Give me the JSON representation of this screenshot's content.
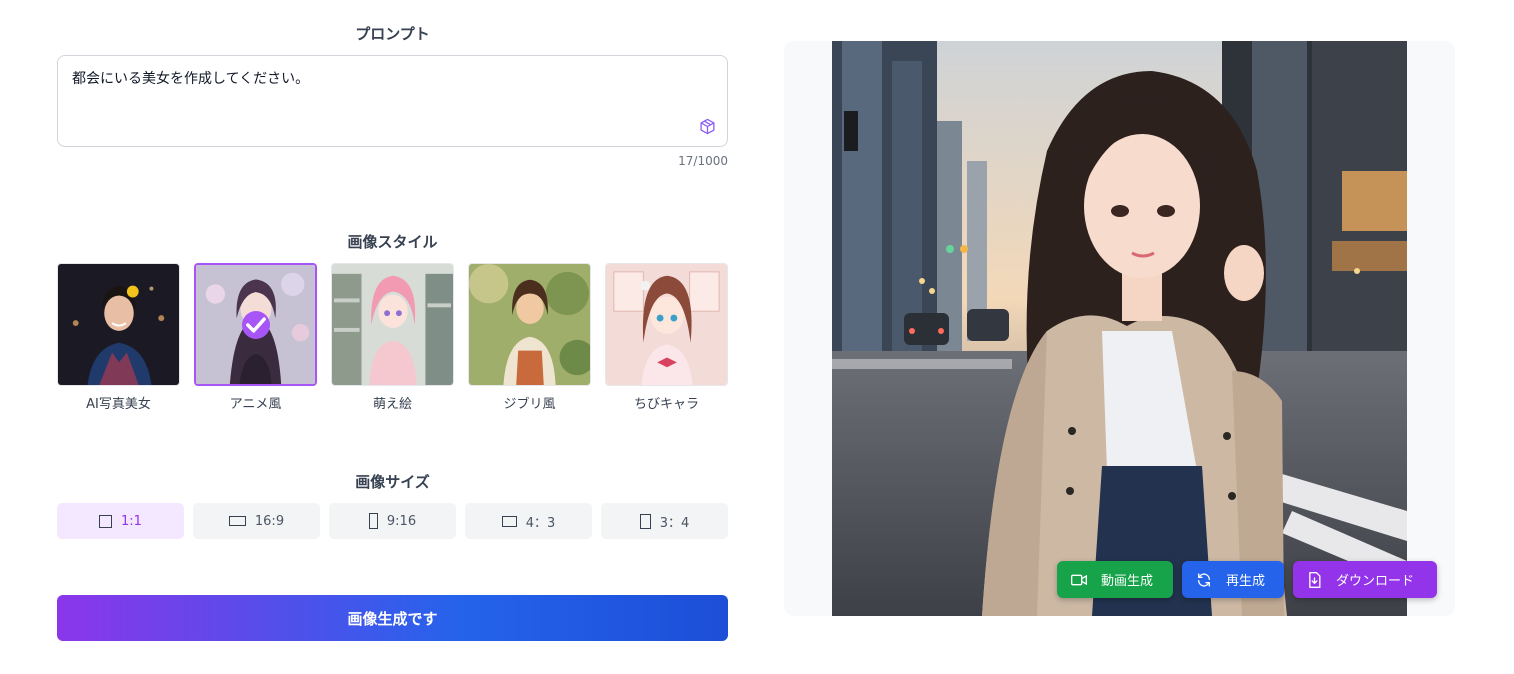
{
  "prompt": {
    "title": "プロンプト",
    "value": "都会にいる美女を作成してください。",
    "counter": "17/1000",
    "icon": "cube-icon"
  },
  "style": {
    "title": "画像スタイル",
    "selected_index": 1,
    "items": [
      {
        "label": "AI写真美女"
      },
      {
        "label": "アニメ風"
      },
      {
        "label": "萌え絵"
      },
      {
        "label": "ジブリ風"
      },
      {
        "label": "ちびキャラ"
      }
    ]
  },
  "size": {
    "title": "画像サイズ",
    "selected_index": 0,
    "options": [
      {
        "label": "1:1",
        "icon": "square-icon"
      },
      {
        "label": "16:9",
        "icon": "landscape-icon"
      },
      {
        "label": "9:16",
        "icon": "portrait-icon"
      },
      {
        "label": "4：3",
        "icon": "landscape-icon"
      },
      {
        "label": "3：4",
        "icon": "portrait-icon"
      }
    ]
  },
  "generate_label": "画像生成です",
  "actions": {
    "video_label": "動画生成",
    "regen_label": "再生成",
    "download_label": "ダウンロード"
  },
  "colors": {
    "accent_purple": "#a855f7",
    "gradient_start": "#8b36ea",
    "gradient_end": "#1d4ed8",
    "video_green": "#16a34a",
    "regen_blue": "#2563eb",
    "download_purple": "#9333ea"
  }
}
